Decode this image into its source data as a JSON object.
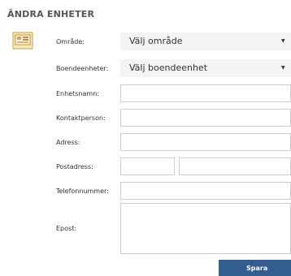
{
  "page": {
    "title": "ÄNDRA ENHETER"
  },
  "logo": {
    "icon": "folder-window-icon"
  },
  "form": {
    "area_label": "Område:",
    "area_value": "Välj område",
    "unit_label": "Boendeenheter:",
    "unit_value": "Välj boendeenhet",
    "unitname_label": "Enhetsnamn:",
    "unitname_value": "",
    "contact_label": "Kontaktperson:",
    "contact_value": "",
    "address_label": "Adress:",
    "address_value": "",
    "postal_label": "Postadress:",
    "postcode_value": "",
    "city_value": "",
    "phone_label": "Telefonnummer:",
    "phone_value": "",
    "email_label": "Epost:",
    "email_value": "",
    "save_label": "Spara"
  }
}
